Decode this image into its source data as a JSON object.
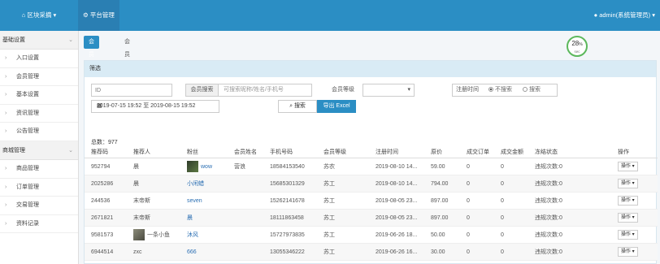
{
  "topbar": {
    "brand": "区块采摘",
    "module": "平台管理",
    "user": "admin(系统管理员)"
  },
  "sidebar": {
    "groups": [
      {
        "label": "基础设置",
        "items": [
          "入口设置",
          "会员管理",
          "基本设置",
          "资讯管理",
          "公告管理"
        ]
      },
      {
        "label": "商城管理",
        "items": [
          "商品管理",
          "订单管理",
          "交易管理",
          "资料记录"
        ]
      }
    ]
  },
  "tabs": {
    "active": "会员管理",
    "inactive": "会员等级"
  },
  "gauge": {
    "value": "28",
    "percent_sign": "%",
    "unit": "sec"
  },
  "filter": {
    "panel_title": "筛选",
    "id_placeholder": "ID",
    "member_prefix": "会员搜索",
    "member_placeholder": "可搜索昵称/姓名/手机号",
    "level_label": "会员等级",
    "reg_label": "注册时间",
    "reg_opt_no": "不搜索",
    "reg_opt_yes": "搜索",
    "date_range": "2019-07-15 19:52 至 2019-08-15 19:52",
    "search_label": "搜索",
    "export_label": "导出 Excel"
  },
  "total": "总数：977",
  "table": {
    "headers": [
      "推荐码",
      "推荐人",
      "粉丝",
      "会员姓名",
      "手机号码",
      "会员等级",
      "注册时间",
      "原价",
      "成交订单",
      "成交金额",
      "冻结状态",
      "操作"
    ],
    "rows": [
      [
        "952794",
        "晨",
        "wow",
        "营浪",
        "18584153540",
        "苏农",
        "2019-08-10 14...",
        "59.00",
        "0",
        "0",
        "违规次数:0",
        "操作"
      ],
      [
        "2025286",
        "晨",
        "小闲蜡",
        "",
        "15685301329",
        "苏工",
        "2019-08-10 14...",
        "794.00",
        "0",
        "0",
        "违规次数:0",
        "操作"
      ],
      [
        "244536",
        "末帝斯",
        "seven",
        "",
        "15262141678",
        "苏工",
        "2019-08-05 23...",
        "897.00",
        "0",
        "0",
        "违规次数:0",
        "操作"
      ],
      [
        "2671821",
        "末帝斯",
        "晨",
        "",
        "18111863458",
        "苏工",
        "2019-08-05 23...",
        "897.00",
        "0",
        "0",
        "违规次数:0",
        "操作"
      ],
      [
        "9581573",
        "一条小鱼",
        "沐风",
        "",
        "15727973835",
        "苏工",
        "2019-06-26 18...",
        "50.00",
        "0",
        "0",
        "违规次数:0",
        "操作"
      ],
      [
        "6944514",
        "zxc",
        "666",
        "",
        "13055346222",
        "苏工",
        "2019-06-26 16...",
        "30.00",
        "0",
        "0",
        "违规次数:0",
        "操作"
      ]
    ]
  }
}
